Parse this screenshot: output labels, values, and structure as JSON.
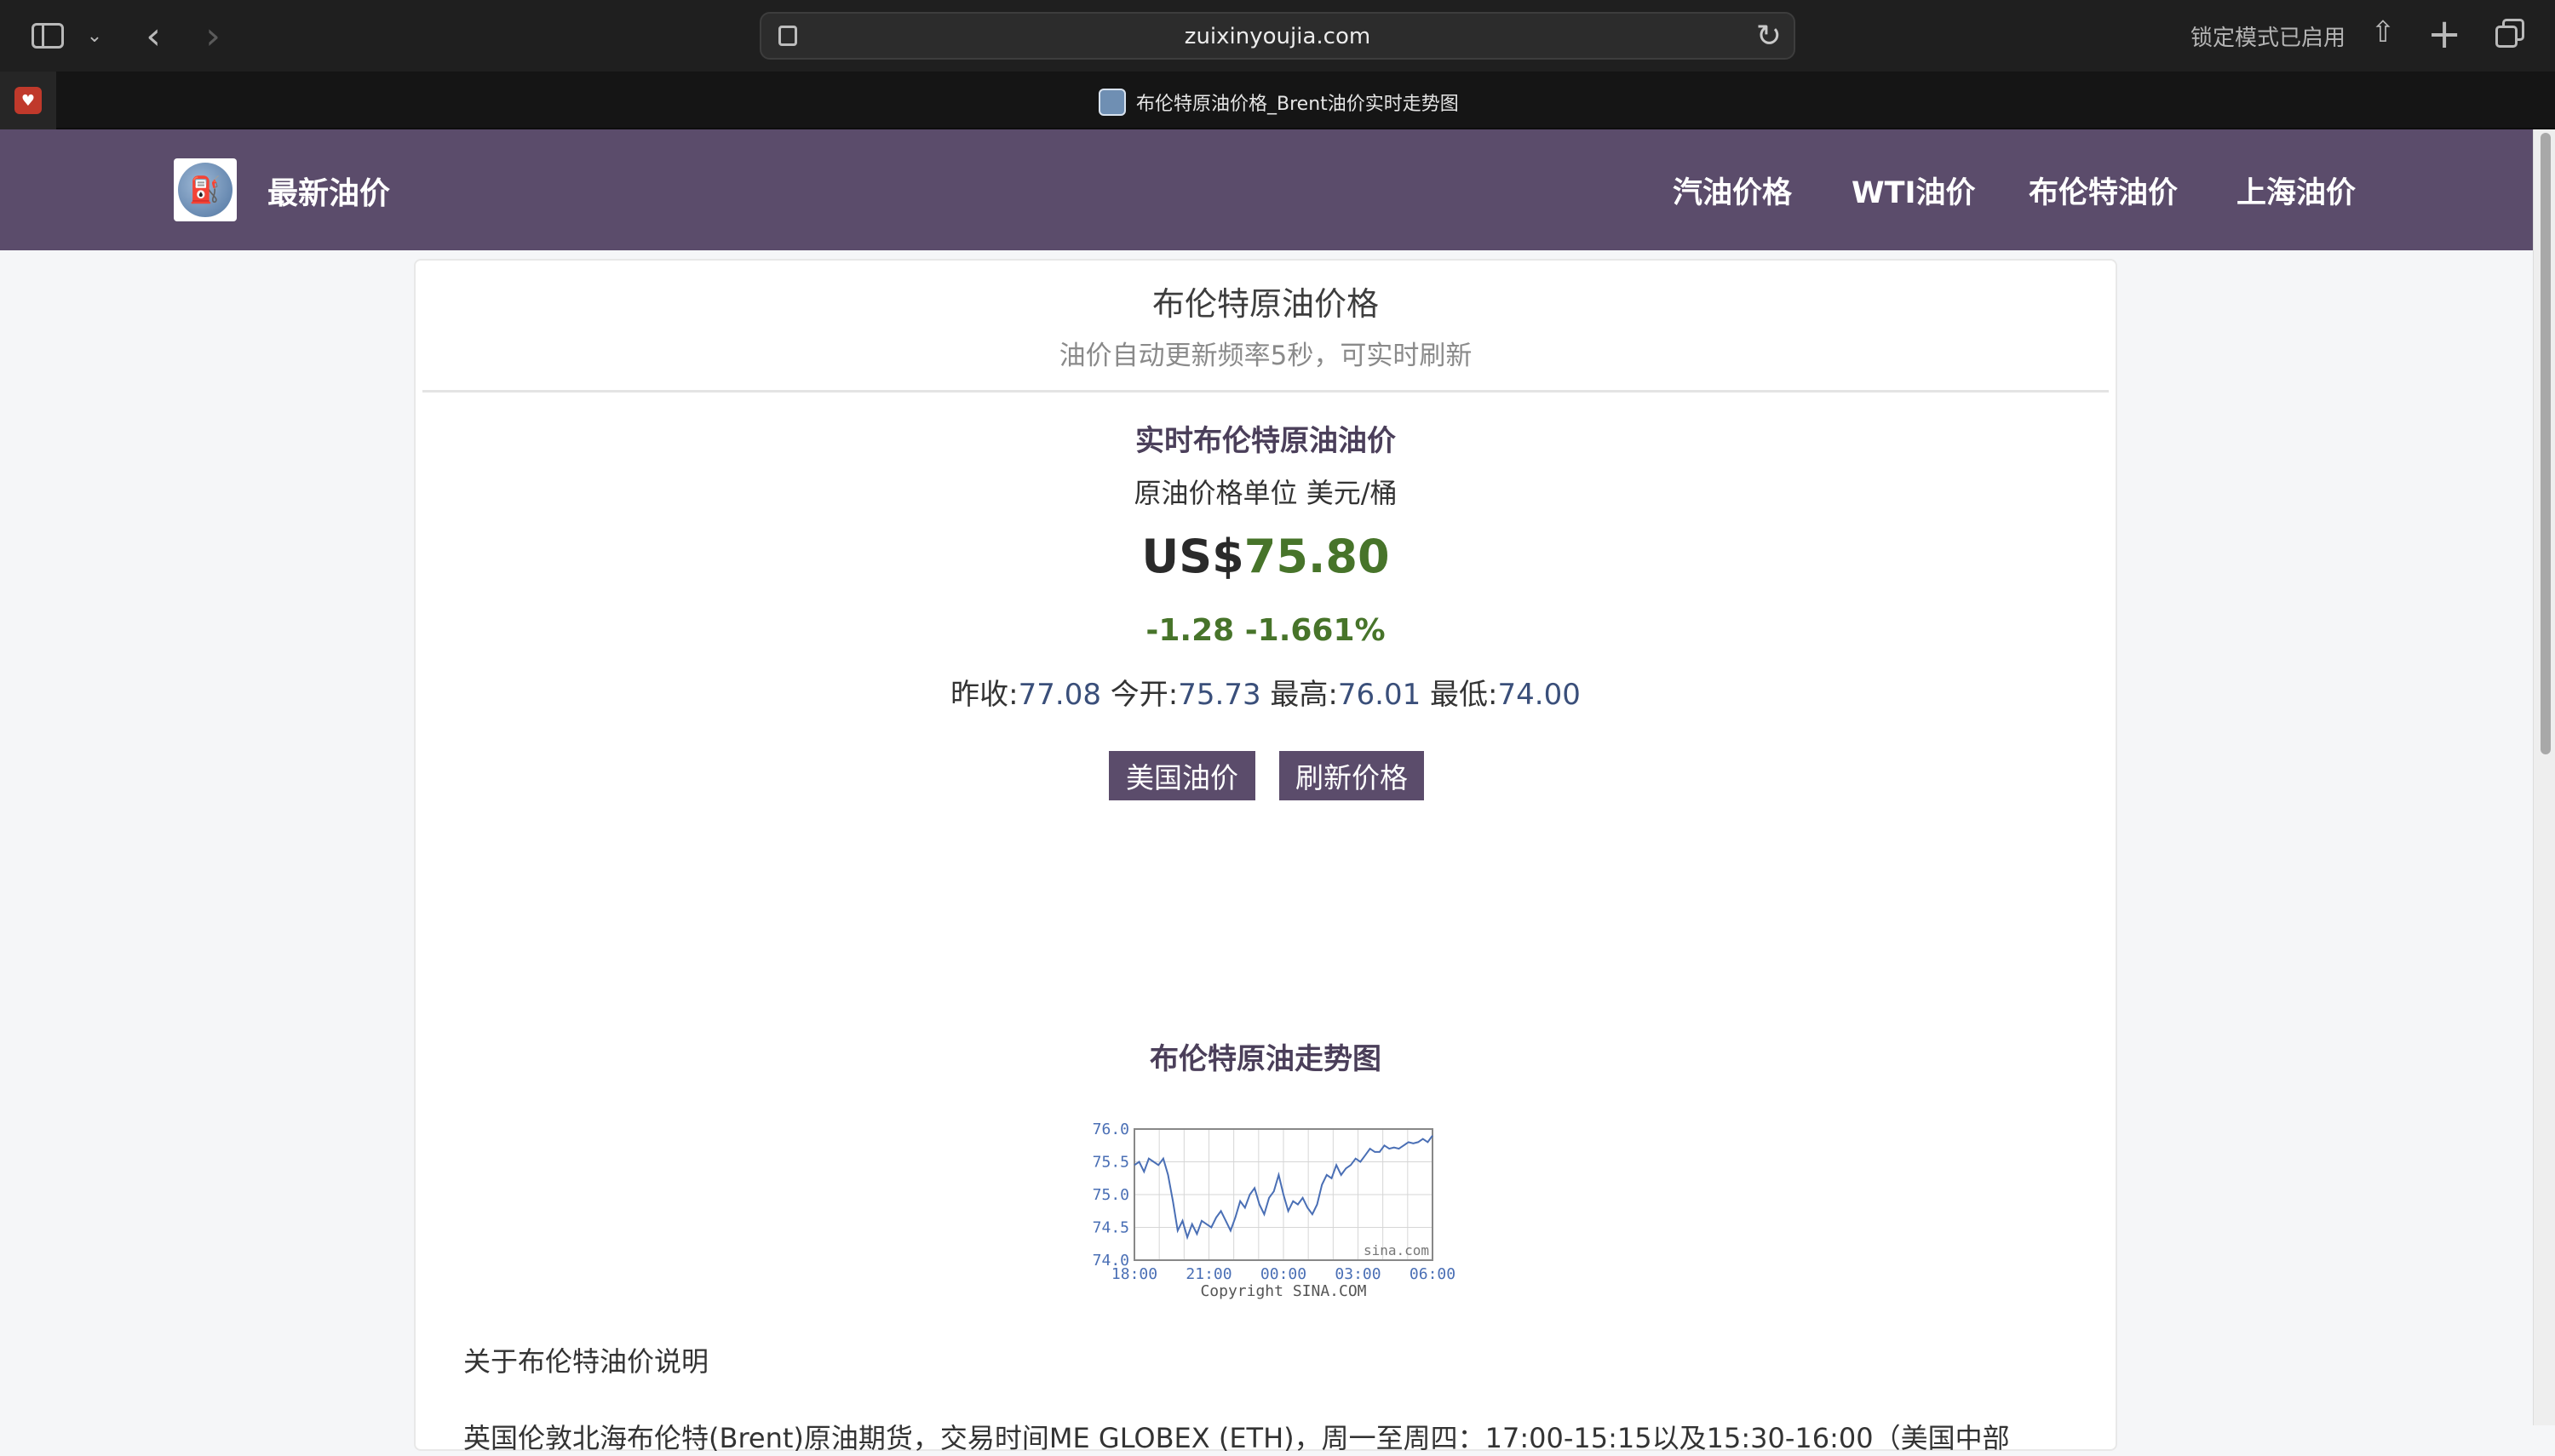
{
  "browser": {
    "url": "zuixinyoujia.com",
    "lockdown_status": "锁定模式已启用",
    "tab_title": "布伦特原油价格_Brent油价实时走势图"
  },
  "site": {
    "name": "最新油价",
    "nav": [
      "汽油价格",
      "WTI油价",
      "布伦特油价",
      "上海油价"
    ]
  },
  "card": {
    "title": "布伦特原油价格",
    "subtitle": "油价自动更新频率5秒，可实时刷新"
  },
  "quote": {
    "heading": "实时布伦特原油油价",
    "unit_text": "原油价格单位 美元/桶",
    "currency": "US$",
    "price": "75.80",
    "change": "-1.28 -1.661%",
    "prev_close_label": "昨收:",
    "prev_close": "77.08",
    "open_label": "今开:",
    "open": "75.73",
    "high_label": "最高:",
    "high": "76.01",
    "low_label": "最低:",
    "low": "74.00",
    "colors": {
      "up_down": "#47742a",
      "accent": "#5b4c6b"
    }
  },
  "buttons": {
    "us_oil": "美国油价",
    "refresh": "刷新价格"
  },
  "chart_section": {
    "title": "布伦特原油走势图"
  },
  "chart_data": {
    "type": "line",
    "title": "",
    "xlabel": "",
    "ylabel": "",
    "x_ticks": [
      "18:00",
      "21:00",
      "00:00",
      "03:00",
      "06:00"
    ],
    "y_ticks": [
      "74.0",
      "74.5",
      "75.0",
      "75.5",
      "76.0"
    ],
    "ylim": [
      74.0,
      76.0
    ],
    "grid": true,
    "watermark": "sina.com",
    "copyright": "Copyright  SINA.COM",
    "series": [
      {
        "values": [
          75.45,
          75.5,
          75.35,
          75.55,
          75.5,
          75.45,
          75.55,
          75.3,
          74.9,
          74.45,
          74.6,
          74.35,
          74.55,
          74.4,
          74.6,
          74.55,
          74.5,
          74.65,
          74.75,
          74.6,
          74.45,
          74.65,
          74.9,
          74.8,
          75.0,
          75.1,
          74.85,
          74.7,
          74.95,
          75.05,
          75.3,
          75.0,
          74.75,
          74.9,
          74.85,
          74.95,
          74.8,
          74.7,
          74.85,
          75.15,
          75.3,
          75.25,
          75.45,
          75.3,
          75.4,
          75.45,
          75.55,
          75.5,
          75.6,
          75.7,
          75.65,
          75.65,
          75.75,
          75.7,
          75.72,
          75.7,
          75.75,
          75.8,
          75.78,
          75.8,
          75.85,
          75.8,
          75.9
        ]
      }
    ]
  },
  "about": {
    "title": "关于布伦特油价说明",
    "text": "英国伦敦北海布伦特(Brent)原油期货，交易时间ME GLOBEX (ETH)，周一至周四：17:00-15:15以及15:30-16:00（美国中部"
  }
}
